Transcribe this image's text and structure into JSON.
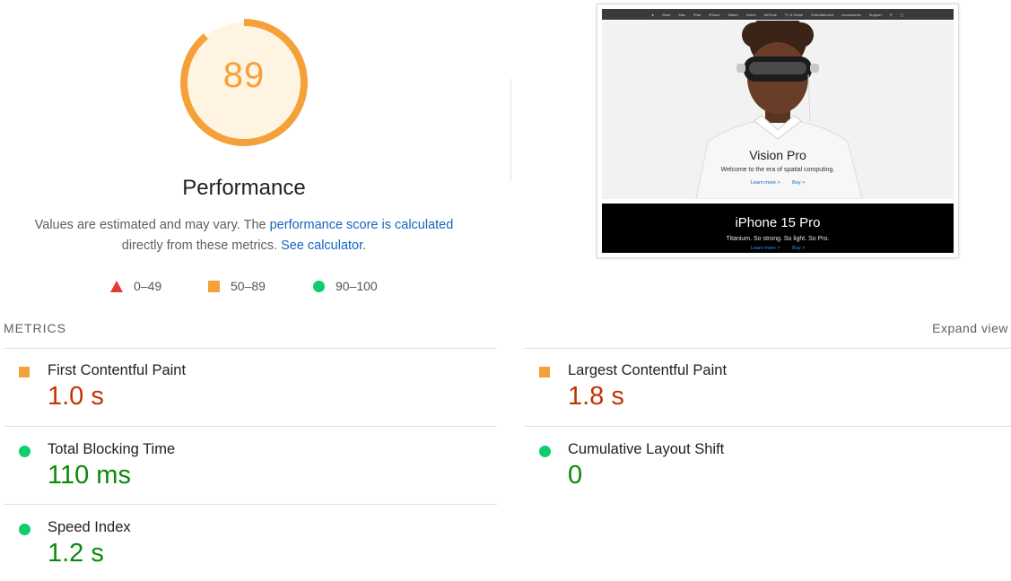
{
  "gauge": {
    "score": "89",
    "score_fraction": 0.89,
    "title": "Performance",
    "ring_color": "#f5a13a",
    "fill_color": "#fff3e2"
  },
  "description": {
    "part1": "Values are estimated and may vary. The ",
    "link1": "performance score is calculated",
    "part2": "directly from these metrics. ",
    "link2": "See calculator",
    "part3": "."
  },
  "legend": [
    {
      "icon": "triangle-red",
      "range": "0–49",
      "color": "#e53935"
    },
    {
      "icon": "square-orange",
      "range": "50–89",
      "color": "#f5a13a"
    },
    {
      "icon": "circle-green",
      "range": "90–100",
      "color": "#0cce6b"
    }
  ],
  "screenshot": {
    "nav_items": [
      "Store",
      "Mac",
      "iPad",
      "iPhone",
      "Watch",
      "Vision",
      "AirPods",
      "TV & Home",
      "Entertainment",
      "Accessories",
      "Support"
    ],
    "hero_title": "Vision Pro",
    "hero_subtitle": "Welcome to the era of spatial computing.",
    "hero_link_learn": "Learn more >",
    "hero_link_buy": "Buy >",
    "iphone_title": "iPhone 15 Pro",
    "iphone_subtitle": "Titanium. So strong. So light. So Pro.",
    "iphone_link_learn": "Learn more >",
    "iphone_link_buy": "Buy >"
  },
  "metrics": {
    "section_label": "METRICS",
    "expand_label": "Expand view",
    "items": [
      {
        "label": "First Contentful Paint",
        "value": "1.0 s",
        "rating": "average"
      },
      {
        "label": "Largest Contentful Paint",
        "value": "1.8 s",
        "rating": "average"
      },
      {
        "label": "Total Blocking Time",
        "value": "110 ms",
        "rating": "good"
      },
      {
        "label": "Cumulative Layout Shift",
        "value": "0",
        "rating": "good"
      },
      {
        "label": "Speed Index",
        "value": "1.2 s",
        "rating": "good"
      }
    ]
  }
}
